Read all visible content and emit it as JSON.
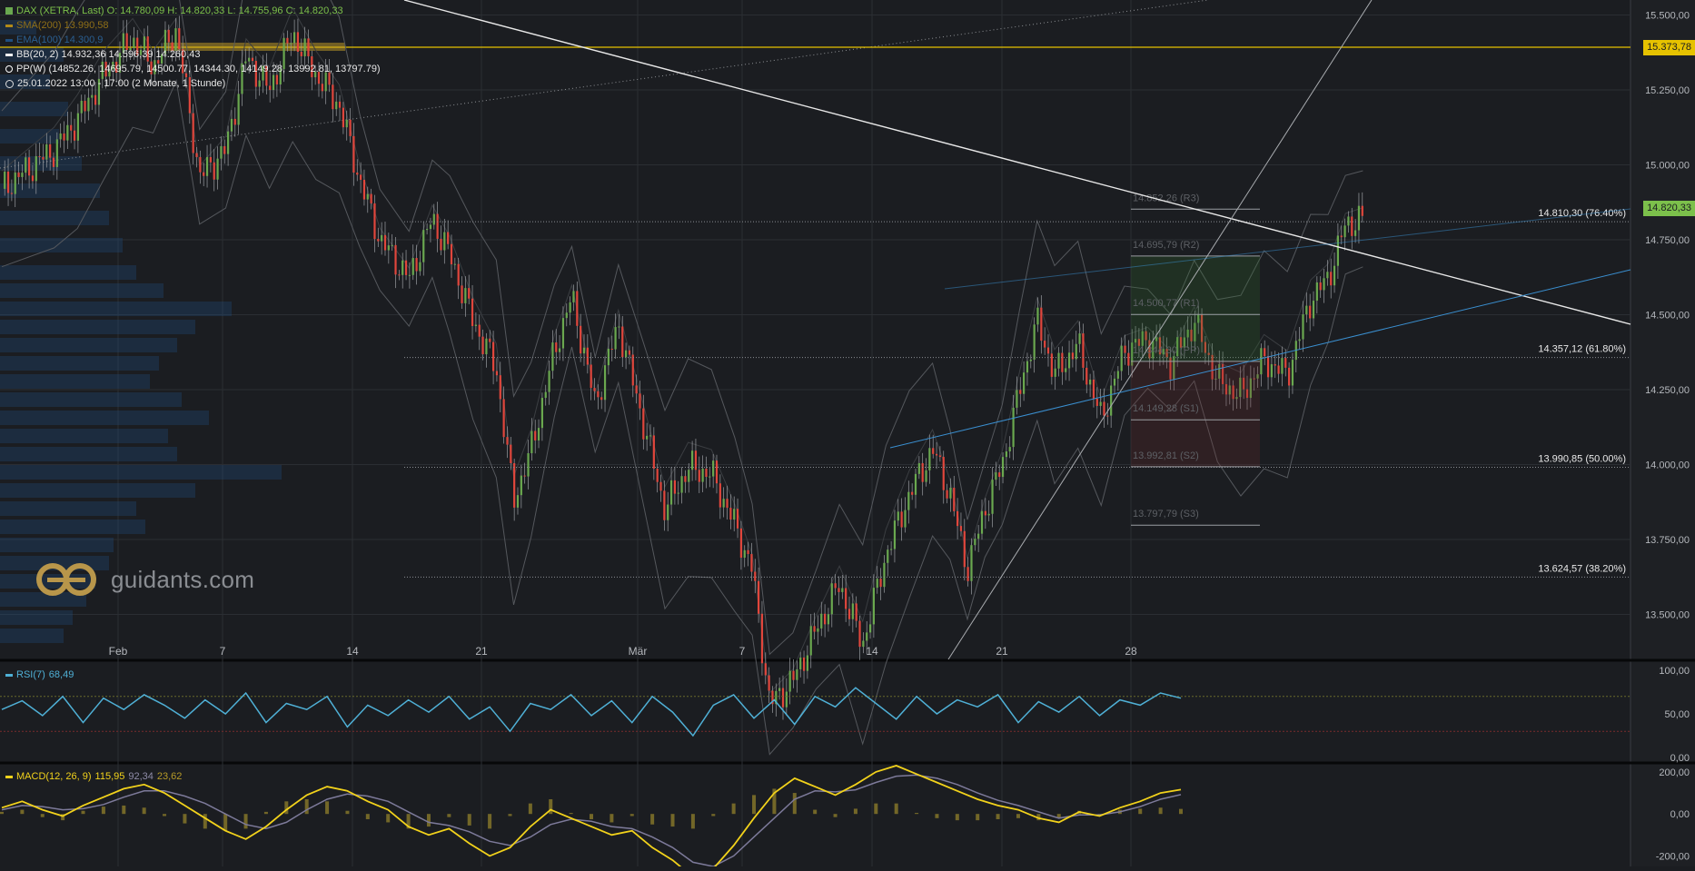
{
  "colors": {
    "background": "#1b1d21",
    "grid": "#2b2e33",
    "bull": "#6aa84f",
    "bear": "#e0463c",
    "rsi": "#4fb0d6",
    "macd": "#f2d21b",
    "signal": "#7d7a9a",
    "level_line": "#e6c200",
    "last_price_bg": "#7cc04b",
    "level_price_bg": "#e6c200",
    "trend": "#e8e8e8",
    "channel": "#3a8fd0"
  },
  "legend": {
    "main": "DAX (XETRA, Last)  O: 14.780,09  H: 14.820,33  L: 14.755,96  C: 14.820,33",
    "sma": "SMA(200)  13.990,58",
    "ema": "EMA(100)  14.300,9",
    "bb": "BB(20, 2)  14.932,36  14.596,39  14.260,43",
    "pp": "PP(W)  (14852.26, 14695.79, 14500.77, 14344.30, 14149.28, 13992.81, 13797.79)",
    "range": "25.01.2022 13:00 - 17:00   (2 Monate, 1 Stunde)"
  },
  "rsi_legend": {
    "name": "RSI(7)",
    "value": "68,49"
  },
  "macd_legend": {
    "name": "MACD(12, 26, 9)",
    "v1": "115,95",
    "v2": "92,34",
    "v3": "23,62"
  },
  "watermark": "guidants.com",
  "price_tags": {
    "level": "15.373,78",
    "last": "14.820,33"
  },
  "chart_data": {
    "type": "line",
    "title": "DAX (XETRA, Last)",
    "y_axis": {
      "range": [
        13350,
        15550
      ],
      "ticks": [
        "15.500,00",
        "15.250,00",
        "15.000,00",
        "14.750,00",
        "14.500,00",
        "14.250,00",
        "14.000,00",
        "13.750,00",
        "13.500,00"
      ]
    },
    "x_axis": {
      "labels": [
        "Feb",
        "7",
        "14",
        "21",
        "Mär",
        "7",
        "14",
        "21",
        "28"
      ]
    },
    "fib_levels": [
      {
        "label": "14.810,30 (76.40%)",
        "value": 14810.3
      },
      {
        "label": "14.357,12 (61.80%)",
        "value": 14357.12
      },
      {
        "label": "13.990,85 (50.00%)",
        "value": 13990.85
      },
      {
        "label": "13.624,57 (38.20%)",
        "value": 13624.57
      }
    ],
    "pivots": [
      {
        "label": "14.852,26 (R3)",
        "value": 14852.26
      },
      {
        "label": "14.695,79 (R2)",
        "value": 14695.79
      },
      {
        "label": "14.500,77 (R1)",
        "value": 14500.77
      },
      {
        "label": "14.344,30 (PP)",
        "value": 14344.3
      },
      {
        "label": "14.149,28 (S1)",
        "value": 14149.28
      },
      {
        "label": "13.992,81 (S2)",
        "value": 13992.81
      },
      {
        "label": "13.797,79 (S3)",
        "value": 13797.79
      }
    ],
    "price_path": [
      {
        "t": 0,
        "p": 14920
      },
      {
        "t": 18,
        "p": 15050
      },
      {
        "t": 26,
        "p": 15150
      },
      {
        "t": 35,
        "p": 15300
      },
      {
        "t": 45,
        "p": 15420
      },
      {
        "t": 52,
        "p": 15330
      },
      {
        "t": 60,
        "p": 15450
      },
      {
        "t": 68,
        "p": 14960
      },
      {
        "t": 77,
        "p": 15050
      },
      {
        "t": 84,
        "p": 15360
      },
      {
        "t": 92,
        "p": 15250
      },
      {
        "t": 100,
        "p": 15440
      },
      {
        "t": 108,
        "p": 15300
      },
      {
        "t": 116,
        "p": 15200
      },
      {
        "t": 123,
        "p": 14950
      },
      {
        "t": 130,
        "p": 14750
      },
      {
        "t": 140,
        "p": 14620
      },
      {
        "t": 148,
        "p": 14820
      },
      {
        "t": 154,
        "p": 14700
      },
      {
        "t": 162,
        "p": 14480
      },
      {
        "t": 170,
        "p": 14320
      },
      {
        "t": 176,
        "p": 13880
      },
      {
        "t": 182,
        "p": 14050
      },
      {
        "t": 190,
        "p": 14380
      },
      {
        "t": 196,
        "p": 14560
      },
      {
        "t": 204,
        "p": 14200
      },
      {
        "t": 212,
        "p": 14470
      },
      {
        "t": 220,
        "p": 14160
      },
      {
        "t": 228,
        "p": 13850
      },
      {
        "t": 236,
        "p": 13990
      },
      {
        "t": 244,
        "p": 13970
      },
      {
        "t": 252,
        "p": 13800
      },
      {
        "t": 258,
        "p": 13650
      },
      {
        "t": 264,
        "p": 13200
      },
      {
        "t": 272,
        "p": 13280
      },
      {
        "t": 280,
        "p": 13450
      },
      {
        "t": 288,
        "p": 13600
      },
      {
        "t": 296,
        "p": 13400
      },
      {
        "t": 304,
        "p": 13700
      },
      {
        "t": 312,
        "p": 13900
      },
      {
        "t": 320,
        "p": 14050
      },
      {
        "t": 326,
        "p": 13900
      },
      {
        "t": 332,
        "p": 13650
      },
      {
        "t": 338,
        "p": 13850
      },
      {
        "t": 344,
        "p": 14000
      },
      {
        "t": 350,
        "p": 14250
      },
      {
        "t": 356,
        "p": 14480
      },
      {
        "t": 362,
        "p": 14300
      },
      {
        "t": 370,
        "p": 14400
      },
      {
        "t": 378,
        "p": 14150
      },
      {
        "t": 386,
        "p": 14380
      },
      {
        "t": 394,
        "p": 14420
      },
      {
        "t": 402,
        "p": 14340
      },
      {
        "t": 410,
        "p": 14480
      },
      {
        "t": 418,
        "p": 14280
      },
      {
        "t": 426,
        "p": 14230
      },
      {
        "t": 434,
        "p": 14350
      },
      {
        "t": 442,
        "p": 14300
      },
      {
        "t": 450,
        "p": 14550
      },
      {
        "t": 456,
        "p": 14620
      },
      {
        "t": 462,
        "p": 14800
      },
      {
        "t": 468,
        "p": 14820
      }
    ],
    "rsi": {
      "range": [
        0,
        100
      ],
      "ticks": [
        "100,00",
        "50,00",
        "0,00"
      ],
      "overbought": 70,
      "oversold": 30,
      "values": [
        55,
        65,
        48,
        70,
        40,
        68,
        55,
        72,
        60,
        45,
        66,
        50,
        74,
        40,
        62,
        55,
        70,
        35,
        60,
        48,
        66,
        52,
        70,
        44,
        58,
        30,
        62,
        55,
        72,
        48,
        65,
        40,
        70,
        52,
        25,
        60,
        72,
        45,
        66,
        38,
        70,
        58,
        80,
        62,
        44,
        70,
        50,
        66,
        58,
        72,
        40,
        64,
        52,
        70,
        48,
        66,
        60,
        74,
        68
      ]
    },
    "macd": {
      "range": [
        -250,
        230
      ],
      "ticks": [
        "200,00",
        "0,00",
        "-200,00"
      ],
      "macd": [
        30,
        60,
        20,
        -10,
        40,
        80,
        120,
        140,
        100,
        40,
        -20,
        -80,
        -120,
        -60,
        20,
        90,
        130,
        110,
        60,
        20,
        -60,
        -100,
        -70,
        -140,
        -200,
        -160,
        -60,
        20,
        -20,
        -60,
        -100,
        -80,
        -160,
        -220,
        -300,
        -260,
        -150,
        -20,
        100,
        170,
        130,
        90,
        140,
        200,
        230,
        190,
        150,
        110,
        70,
        40,
        20,
        -20,
        -40,
        10,
        -10,
        30,
        60,
        100,
        116
      ],
      "signal": [
        20,
        40,
        35,
        20,
        25,
        45,
        80,
        110,
        110,
        85,
        50,
        0,
        -50,
        -70,
        -40,
        20,
        70,
        95,
        85,
        60,
        10,
        -40,
        -55,
        -85,
        -130,
        -150,
        -110,
        -50,
        -25,
        -35,
        -60,
        -70,
        -110,
        -160,
        -230,
        -250,
        -200,
        -110,
        -20,
        70,
        110,
        105,
        115,
        150,
        180,
        185,
        170,
        140,
        100,
        65,
        40,
        10,
        -20,
        -5,
        -5,
        10,
        35,
        70,
        92
      ]
    }
  }
}
